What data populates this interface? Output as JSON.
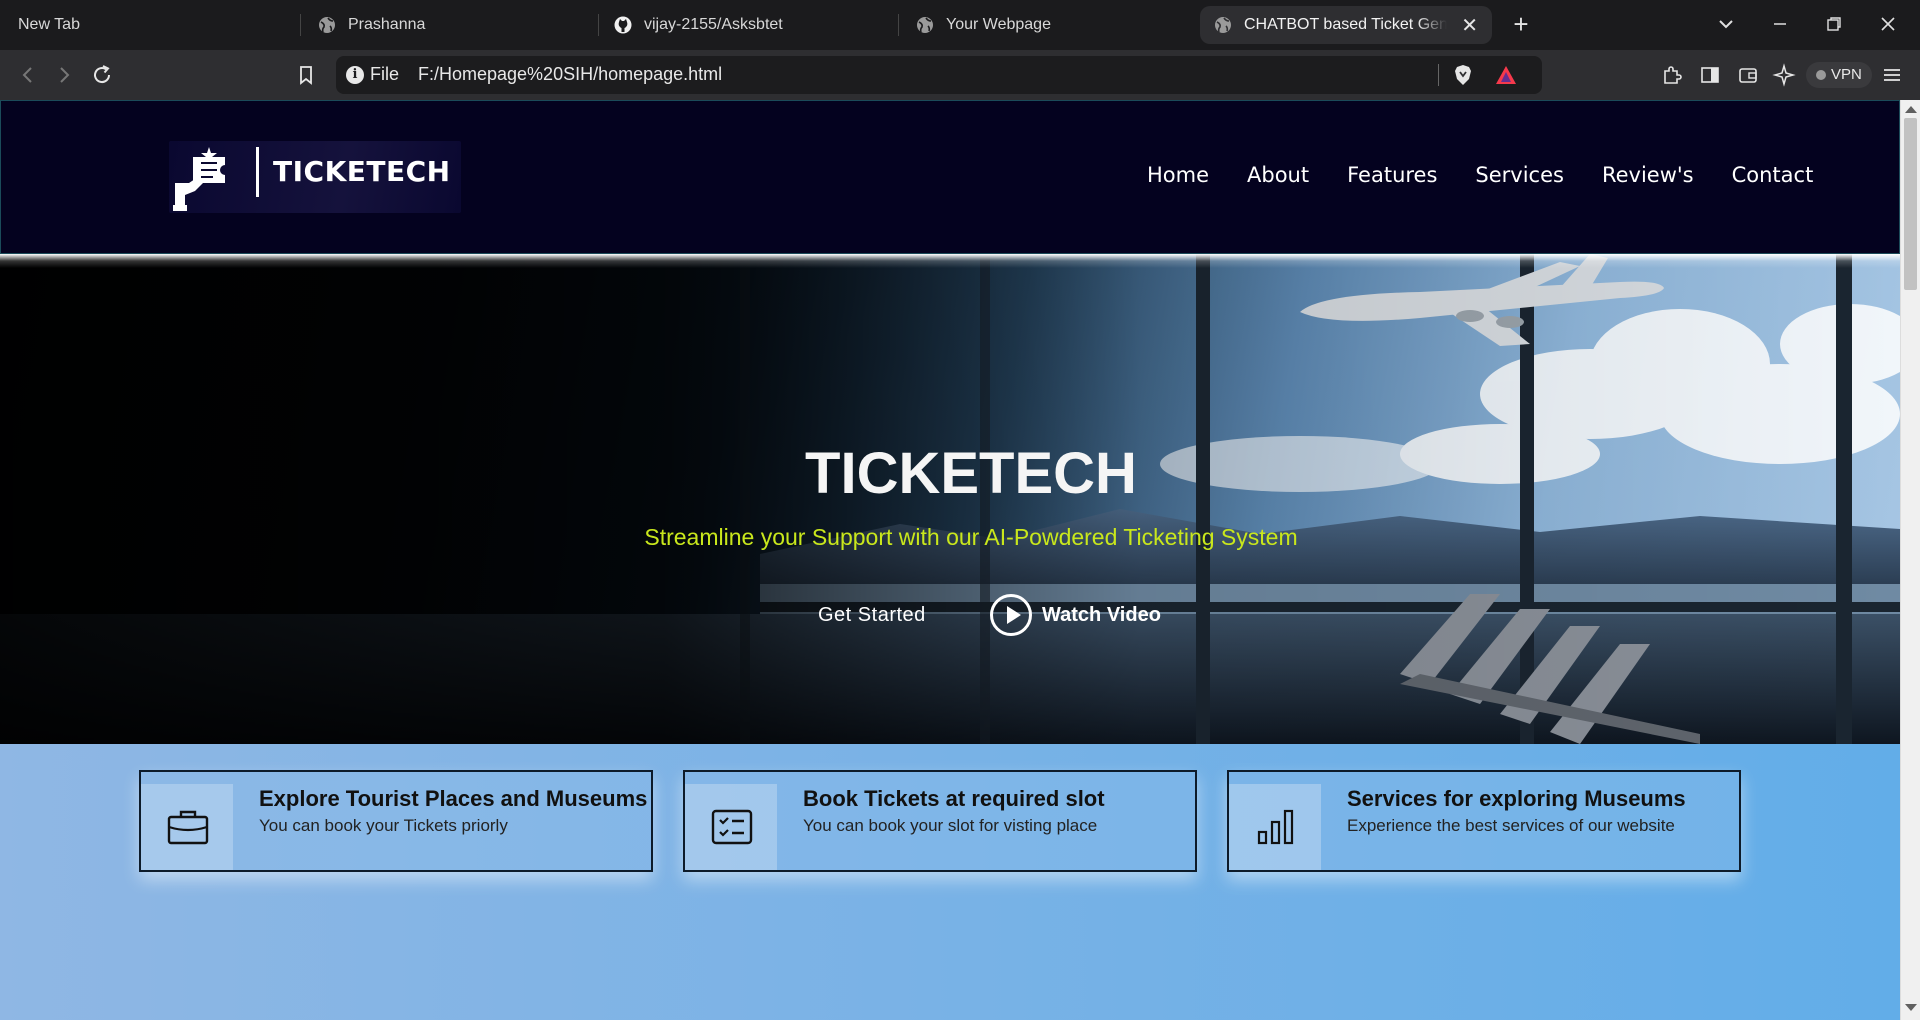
{
  "browser": {
    "tabs": [
      {
        "title": "New Tab",
        "icon": "none"
      },
      {
        "title": "Prashanna",
        "icon": "globe-icon"
      },
      {
        "title": "vijay-2155/Asksbtet",
        "icon": "github-icon"
      },
      {
        "title": "Your Webpage",
        "icon": "globe-icon"
      },
      {
        "title": "CHATBOT based Ticket Generat",
        "icon": "globe-icon",
        "active": true
      }
    ],
    "address": {
      "scheme": "File",
      "url": "F:/Homepage%20SIH/homepage.html"
    },
    "vpn_label": "VPN"
  },
  "site": {
    "logo_text": "TICKETECH",
    "nav": [
      "Home",
      "About",
      "Features",
      "Services",
      "Review's",
      "Contact"
    ],
    "hero": {
      "title": "TICKETECH",
      "subtitle": "Streamline your Support with our AI-Powdered Ticketing System",
      "cta_primary": "Get Started",
      "cta_video": "Watch Video"
    },
    "cards": [
      {
        "icon": "briefcase-icon",
        "title": "Explore Tourist Places and Museums",
        "desc": "You can book your Tickets priorly"
      },
      {
        "icon": "checklist-icon",
        "title": "Book Tickets at required slot",
        "desc": "You can book your slot for visting place"
      },
      {
        "icon": "bar-chart-icon",
        "title": "Services for exploring Museums",
        "desc": "Experience the best services of our website"
      }
    ]
  },
  "colors": {
    "header_bg": "#04021f",
    "subtitle_accent": "#c9e71c",
    "features_bg": "#62ade8"
  }
}
